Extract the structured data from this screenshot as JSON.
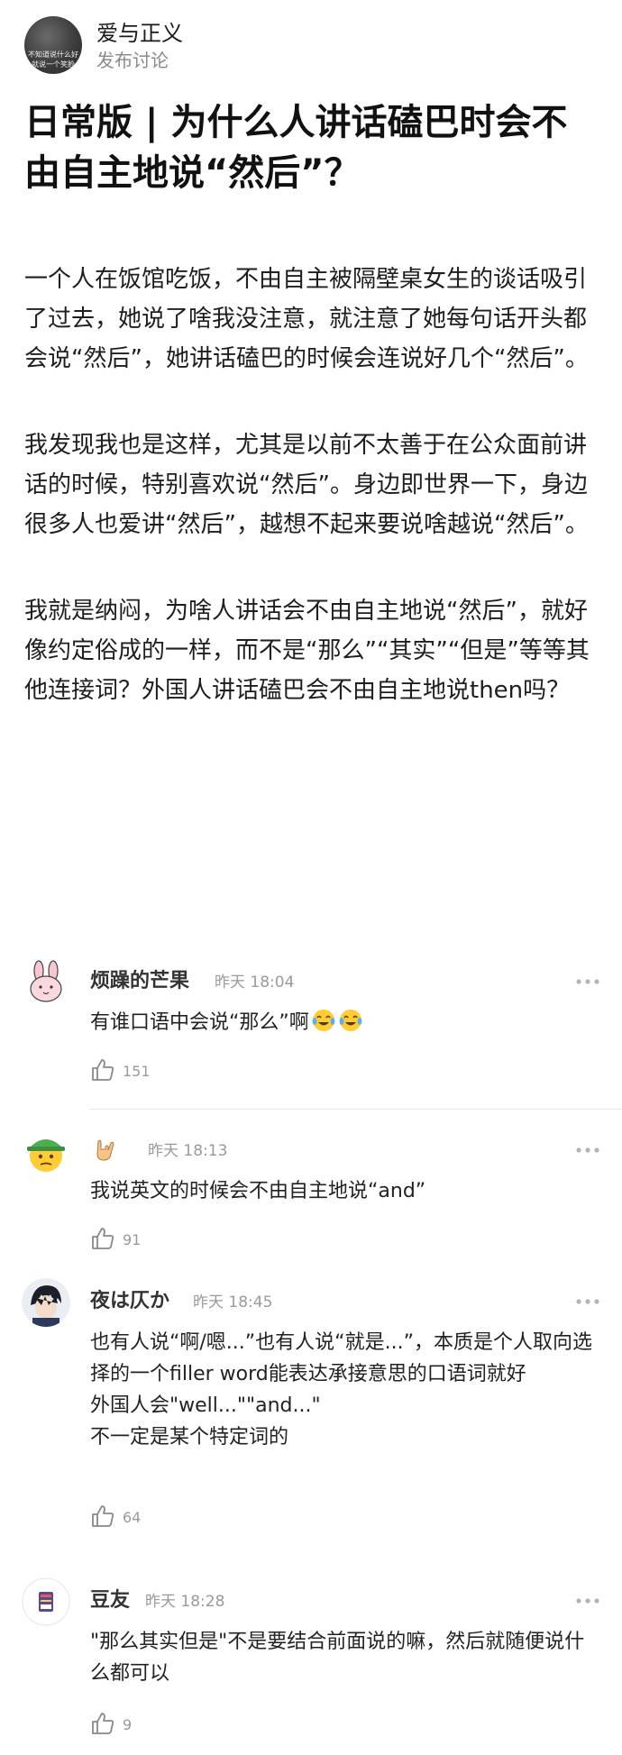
{
  "author": {
    "name": "爱与正义",
    "post_type": "发布讨论",
    "avatar_caption_1": "不知道说什么好",
    "avatar_caption_2": "就说一个笑脸"
  },
  "post": {
    "title": "日常版 | 为什么人讲话磕巴时会不由自主地说“然后”？",
    "paragraphs": [
      "一个人在饭馆吃饭，不由自主被隔壁桌女生的谈话吸引了过去，她说了啥我没注意，就注意了她每句话开头都会说“然后”，她讲话磕巴的时候会连说好几个“然后”。",
      "我发现我也是这样，尤其是以前不太善于在公众面前讲话的时候，特别喜欢说“然后”。身边即世界一下，身边很多人也爱讲“然后”，越想不起来要说啥越说“然后”。",
      "我就是纳闷，为啥人讲话会不由自主地说“然后”，就好像约定俗成的一样，而不是“那么”“其实”“但是”等等其他连接词？外国人讲话磕巴会不由自主地说then吗？"
    ]
  },
  "comments": [
    {
      "name": "烦躁的芒果",
      "time": "昨天 18:04",
      "lines": [
        "有谁口语中会说“那么”啊"
      ],
      "emoji_icons": [
        "tears-of-joy-emoji-icon",
        "tears-of-joy-emoji-icon"
      ],
      "likes": "151",
      "avatar_icon": "pink-rabbit-avatar-icon"
    },
    {
      "name": "",
      "name_icon": "rock-hand-icon",
      "time": "昨天 18:13",
      "lines": [
        "我说英文的时候会不由自主地说“and”"
      ],
      "likes": "91",
      "avatar_icon": "green-cap-emoji-avatar-icon"
    },
    {
      "name": "夜は仄か",
      "time": "昨天 18:45",
      "lines": [
        "也有人说“啊/嗯...”也有人说“就是...”，本质是个人取向选择的一个filler word能表达承接意思的口语词就好",
        "外国人会\"well...\"\"and...\"",
        "不一定是某个特定词的"
      ],
      "likes": "64",
      "avatar_icon": "anime-character-avatar-icon"
    },
    {
      "name": "豆友",
      "time": "昨天 18:28",
      "lines": [
        "\"那么其实但是\"不是要结合前面说的嘛，然后就随便说什么都可以"
      ],
      "likes": "9",
      "avatar_icon": "douban-default-avatar-icon"
    }
  ],
  "colors": {
    "text_primary": "#1e1e1e",
    "text_secondary": "#8a8a8a",
    "meta_gray": "#9a9a9a",
    "divider": "#e6e6e6"
  }
}
